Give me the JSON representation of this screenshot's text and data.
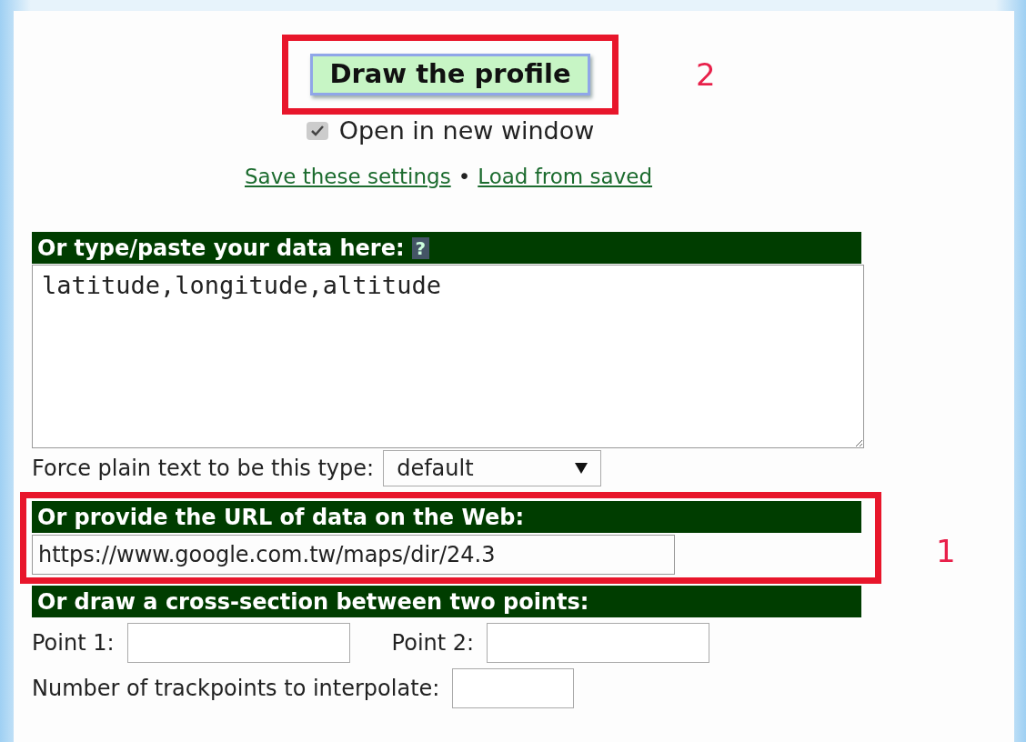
{
  "draw_button": {
    "label": "Draw the profile",
    "callout": "2"
  },
  "open_new_window": {
    "label": "Open in new window",
    "checked": true
  },
  "links": [
    {
      "label": "Save these settings"
    },
    {
      "label": "Load from saved"
    }
  ],
  "link_separator": "•",
  "paste_section": {
    "heading": "Or type/paste your data here:",
    "help": "?",
    "value": "latitude,longitude,altitude"
  },
  "force_type": {
    "label": "Force plain text to be this type:",
    "value": "default"
  },
  "url_section": {
    "heading": "Or provide the URL of data on the Web:",
    "value": "https://www.google.com.tw/maps/dir/24.3",
    "callout": "1"
  },
  "cross_section": {
    "heading": "Or draw a cross-section between two points:",
    "point1_label": "Point 1:",
    "point2_label": "Point 2:",
    "trackpoints_label": "Number of trackpoints to interpolate:"
  }
}
